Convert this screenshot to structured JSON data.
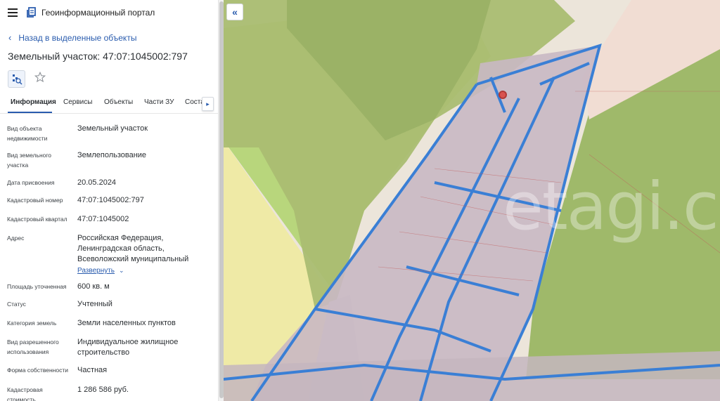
{
  "header": {
    "portal_title": "Геоинформационный портал"
  },
  "nav": {
    "back_label": "Назад в выделенные объекты"
  },
  "object": {
    "title": "Земельный участок: 47:07:1045002:797"
  },
  "tabs": [
    {
      "label": "Информация",
      "active": true
    },
    {
      "label": "Сервисы",
      "active": false
    },
    {
      "label": "Объекты",
      "active": false
    },
    {
      "label": "Части ЗУ",
      "active": false
    },
    {
      "label": "Соста",
      "active": false
    }
  ],
  "properties": [
    {
      "label": "Вид объекта недвижимости",
      "value": "Земельный участок"
    },
    {
      "label": "Вид земельного участка",
      "value": "Землепользование"
    },
    {
      "label": "Дата присвоения",
      "value": "20.05.2024"
    },
    {
      "label": "Кадастровый номер",
      "value": "47:07:1045002:797"
    },
    {
      "label": "Кадастровый квартал",
      "value": "47:07:1045002"
    },
    {
      "label": "Адрес",
      "value": "Российская Федерация, Ленинградская область, Всеволожский муниципальный",
      "expand_label": "Развернуть"
    },
    {
      "label": "Площадь уточненная",
      "value": "600 кв. м"
    },
    {
      "label": "Статус",
      "value": "Учтенный"
    },
    {
      "label": "Категория земель",
      "value": "Земли населенных пунктов"
    },
    {
      "label": "Вид разрешенного использования",
      "value": "Индивидуальное жилищное строительство"
    },
    {
      "label": "Форма собственности",
      "value": "Частная"
    },
    {
      "label": "Кадастровая стоимость",
      "value": "1 286 586 руб."
    }
  ],
  "map": {
    "watermark": "etagi.co"
  },
  "colors": {
    "accent": "#2a5cae",
    "parcel_blue": "#3a7fd5",
    "forest": "#8fae63",
    "light_green": "#b9d77f",
    "yellow": "#eeeaa6"
  },
  "icons": {
    "menu": "hamburger-icon",
    "logo": "portal-logo-icon",
    "back": "chevron-left-icon",
    "tool": "select-search-icon",
    "favorite": "star-icon",
    "tab_next": "chevron-right-icon",
    "collapse": "double-chevron-left-icon",
    "expand": "chevron-down-icon"
  }
}
